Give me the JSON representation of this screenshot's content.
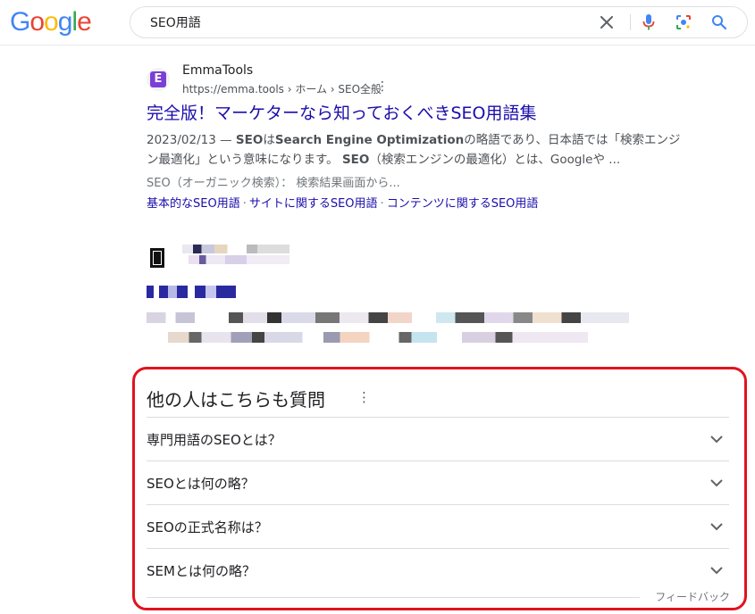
{
  "header": {
    "logo_letters": [
      {
        "ch": "G",
        "color": "#4285F4"
      },
      {
        "ch": "o",
        "color": "#EA4335"
      },
      {
        "ch": "o",
        "color": "#FBBC05"
      },
      {
        "ch": "g",
        "color": "#4285F4"
      },
      {
        "ch": "l",
        "color": "#34A853"
      },
      {
        "ch": "e",
        "color": "#EA4335"
      }
    ],
    "search_value": "SEO用語"
  },
  "result": {
    "site_name": "EmmaTools",
    "favicon_letter": "E",
    "url": "https://emma.tools › ホーム › SEO全般",
    "title": "完全版！マーケターなら知っておくべきSEO用語集",
    "date": "2023/02/13 — ",
    "snip_b1": "SEO",
    "snip_t1": "は",
    "snip_b2": "Search Engine Optimization",
    "snip_t2": "の略語であり、日本語では「検索エンジン最適化」という意味になります。 ",
    "snip_b3": "SEO",
    "snip_t3": "（検索エンジンの最適化）とは、Googleや ...",
    "snippet2": "SEO（オーガニック検索）：  検索結果画面から...",
    "sitelinks": [
      "基本的なSEO用語",
      "サイトに関するSEO用語",
      "コンテンツに関するSEO用語"
    ],
    "sitelink_sep": "·"
  },
  "paa": {
    "heading": "他の人はこちらも質問",
    "questions": [
      "専門用語のSEOとは？",
      "SEOとは何の略？",
      "SEOの正式名称は？",
      "SEMとは何の略？"
    ],
    "feedback": "フィードバック"
  }
}
